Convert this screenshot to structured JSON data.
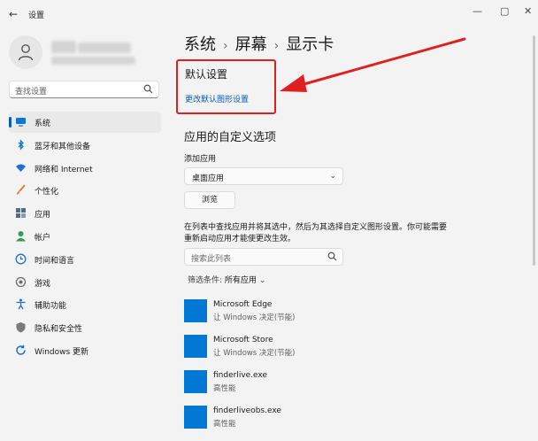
{
  "window": {
    "back_icon": "back-arrow-icon",
    "title": "设置",
    "controls": [
      "—",
      "▢",
      "✕"
    ]
  },
  "sidebar": {
    "search_placeholder": "查找设置",
    "items": [
      {
        "label": "系统",
        "icon": "monitor-icon",
        "active": true,
        "color": "#0a78d4"
      },
      {
        "label": "蓝牙和其他设备",
        "icon": "bluetooth-icon",
        "color": "#0a78d4"
      },
      {
        "label": "网络和 Internet",
        "icon": "wifi-icon",
        "color": "#1f6fd1"
      },
      {
        "label": "个性化",
        "icon": "brush-icon",
        "color": "#d9822b"
      },
      {
        "label": "应用",
        "icon": "apps-icon",
        "color": "#5a6b7d"
      },
      {
        "label": "帐户",
        "icon": "account-icon",
        "color": "#2e9d5c"
      },
      {
        "label": "时间和语言",
        "icon": "globe-clock-icon",
        "color": "#1f6fd1"
      },
      {
        "label": "游戏",
        "icon": "gamepad-icon",
        "color": "#6b6b6b"
      },
      {
        "label": "辅助功能",
        "icon": "accessibility-icon",
        "color": "#1f6fd1"
      },
      {
        "label": "隐私和安全性",
        "icon": "shield-icon",
        "color": "#7a7a7a"
      },
      {
        "label": "Windows 更新",
        "icon": "update-icon",
        "color": "#1f6fd1"
      }
    ]
  },
  "breadcrumb": [
    "系统",
    "屏幕",
    "显示卡"
  ],
  "default_settings": {
    "title": "默认设置",
    "link": "更改默认图形设置"
  },
  "custom": {
    "title": "应用的自定义选项",
    "add_label": "添加应用",
    "select_value": "桌面应用",
    "browse_label": "浏览",
    "description": "在列表中查找应用并将其选中，然后为其选择自定义图形设置。你可能需要重新启动应用才能使更改生效。",
    "search_placeholder": "搜索此列表",
    "filter_prefix": "筛选条件:",
    "filter_value": "所有应用"
  },
  "apps": [
    {
      "name": "Microsoft Edge",
      "status": "让 Windows 决定(节能)"
    },
    {
      "name": "Microsoft Store",
      "status": "让 Windows 决定(节能)"
    },
    {
      "name": "finderlive.exe",
      "status": "高性能"
    },
    {
      "name": "finderliveobs.exe",
      "status": "高性能"
    }
  ],
  "colors": {
    "accent": "#005fb8",
    "annotation": "#e02020",
    "tile": "#0078d4"
  }
}
